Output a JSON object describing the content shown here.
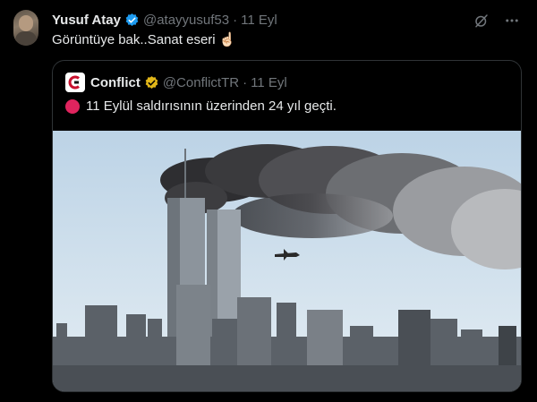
{
  "tweet": {
    "author_name": "Yusuf Atay",
    "handle": "@atayyusuf53",
    "separator": "·",
    "time": "11 Eyl",
    "text": "Görüntüye bak..Sanat eseri",
    "emoji": "☝🏻"
  },
  "quoted": {
    "author_name": "Conflict",
    "handle": "@ConflictTR",
    "separator": "·",
    "time": "11 Eyl",
    "text": "11 Eylül saldırısının üzerinden 24 yıl geçti."
  },
  "icons": {
    "verified": "verified-badge-icon",
    "grok": "grok-icon",
    "more": "more-icon"
  },
  "colors": {
    "verified_blue": "#1d9bf0",
    "verified_gold": "#e2b719",
    "status_red": "#e0245e"
  }
}
